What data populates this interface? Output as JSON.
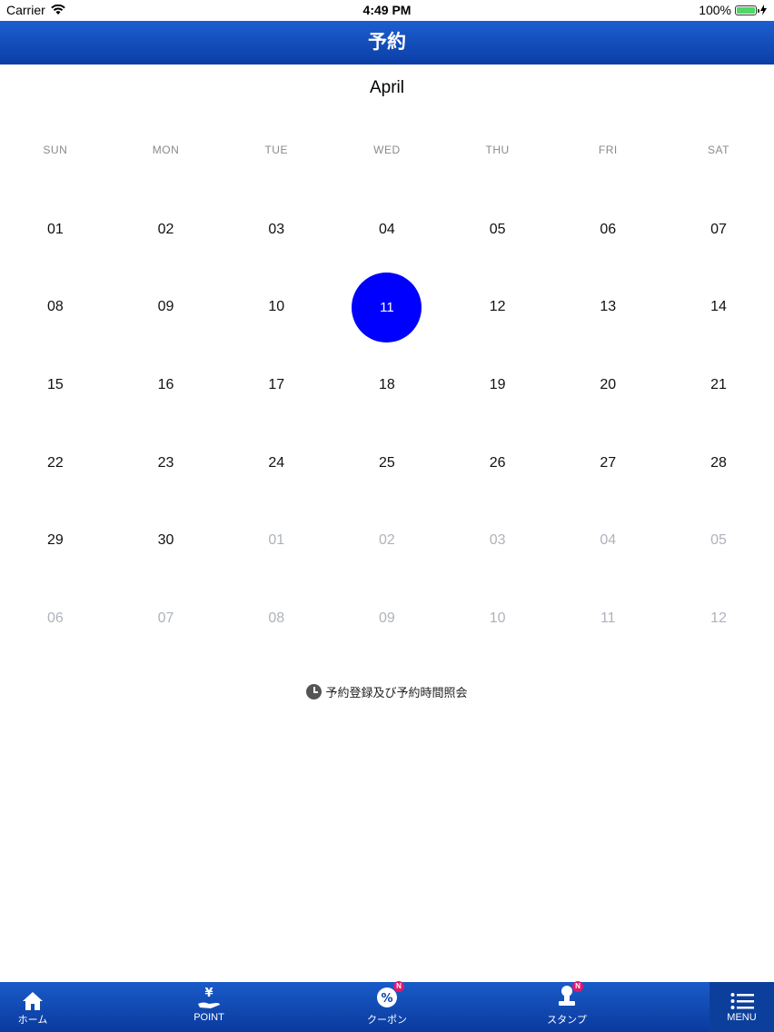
{
  "status_bar": {
    "carrier": "Carrier",
    "time": "4:49 PM",
    "battery": "100%"
  },
  "nav": {
    "title": "予約"
  },
  "calendar": {
    "month": "April",
    "weekdays": [
      "SUN",
      "MON",
      "TUE",
      "WED",
      "THU",
      "FRI",
      "SAT"
    ],
    "selected_day": "11",
    "days": [
      {
        "d": "01",
        "other": false
      },
      {
        "d": "02",
        "other": false
      },
      {
        "d": "03",
        "other": false
      },
      {
        "d": "04",
        "other": false
      },
      {
        "d": "05",
        "other": false
      },
      {
        "d": "06",
        "other": false
      },
      {
        "d": "07",
        "other": false
      },
      {
        "d": "08",
        "other": false
      },
      {
        "d": "09",
        "other": false
      },
      {
        "d": "10",
        "other": false
      },
      {
        "d": "11",
        "other": false,
        "selected": true
      },
      {
        "d": "12",
        "other": false
      },
      {
        "d": "13",
        "other": false
      },
      {
        "d": "14",
        "other": false
      },
      {
        "d": "15",
        "other": false
      },
      {
        "d": "16",
        "other": false
      },
      {
        "d": "17",
        "other": false
      },
      {
        "d": "18",
        "other": false
      },
      {
        "d": "19",
        "other": false
      },
      {
        "d": "20",
        "other": false
      },
      {
        "d": "21",
        "other": false
      },
      {
        "d": "22",
        "other": false
      },
      {
        "d": "23",
        "other": false
      },
      {
        "d": "24",
        "other": false
      },
      {
        "d": "25",
        "other": false
      },
      {
        "d": "26",
        "other": false
      },
      {
        "d": "27",
        "other": false
      },
      {
        "d": "28",
        "other": false
      },
      {
        "d": "29",
        "other": false
      },
      {
        "d": "30",
        "other": false
      },
      {
        "d": "01",
        "other": true
      },
      {
        "d": "02",
        "other": true
      },
      {
        "d": "03",
        "other": true
      },
      {
        "d": "04",
        "other": true
      },
      {
        "d": "05",
        "other": true
      },
      {
        "d": "06",
        "other": true
      },
      {
        "d": "07",
        "other": true
      },
      {
        "d": "08",
        "other": true
      },
      {
        "d": "09",
        "other": true
      },
      {
        "d": "10",
        "other": true
      },
      {
        "d": "11",
        "other": true
      },
      {
        "d": "12",
        "other": true
      }
    ]
  },
  "reserve_link": {
    "label": "予約登録及び予約時間照会"
  },
  "tabs": [
    {
      "label": "ホーム",
      "icon": "home-icon"
    },
    {
      "label": "POINT",
      "icon": "yen-hand-icon"
    },
    {
      "label": "クーポン",
      "icon": "coupon-icon",
      "badge": "N"
    },
    {
      "label": "スタンプ",
      "icon": "stamp-icon",
      "badge": "N"
    },
    {
      "label": "MENU",
      "icon": "menu-icon"
    }
  ],
  "colors": {
    "nav": "#1c5fd0",
    "selected": "#0000ff",
    "badge": "#e0186c"
  }
}
